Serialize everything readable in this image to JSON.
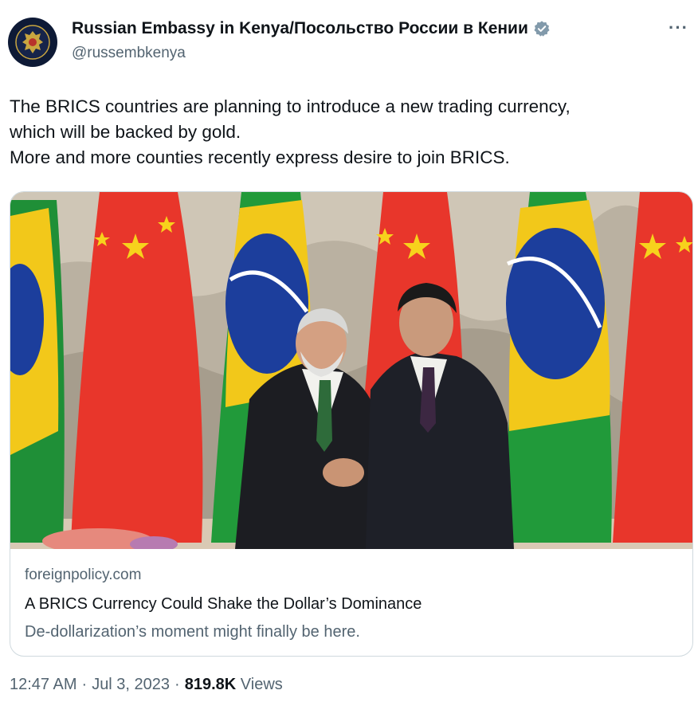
{
  "author": {
    "display_name": "Russian Embassy in Kenya/Посольство России в Кении",
    "handle": "@russembkenya",
    "verified_icon": "verified-badge-icon",
    "avatar_icon": "coat-of-arms-icon"
  },
  "menu": {
    "more_label": "···"
  },
  "tweet": {
    "lines": [
      "The BRICS countries are planning to introduce a new trading currency,",
      "which will be backed by gold.",
      "More and more counties recently express desire to join BRICS."
    ]
  },
  "card": {
    "image_icon": "photo-handshake-flags",
    "domain": "foreignpolicy.com",
    "title": "A BRICS Currency Could Shake the Dollar’s Dominance",
    "description": "De-dollarization’s moment might finally be here."
  },
  "footer": {
    "time": "12:47 AM",
    "sep1": "·",
    "date": "Jul 3, 2023",
    "sep2": "·",
    "views_count": "819.8K",
    "views_label": "Views"
  },
  "colors": {
    "text": "#0f1419",
    "secondary": "#536471",
    "border": "#cfd9de",
    "verified": "#829aab",
    "china_red": "#e8362b",
    "brazil_green": "#219a3a",
    "brazil_yellow": "#f2c81a",
    "brazil_blue": "#1c3e9c"
  }
}
